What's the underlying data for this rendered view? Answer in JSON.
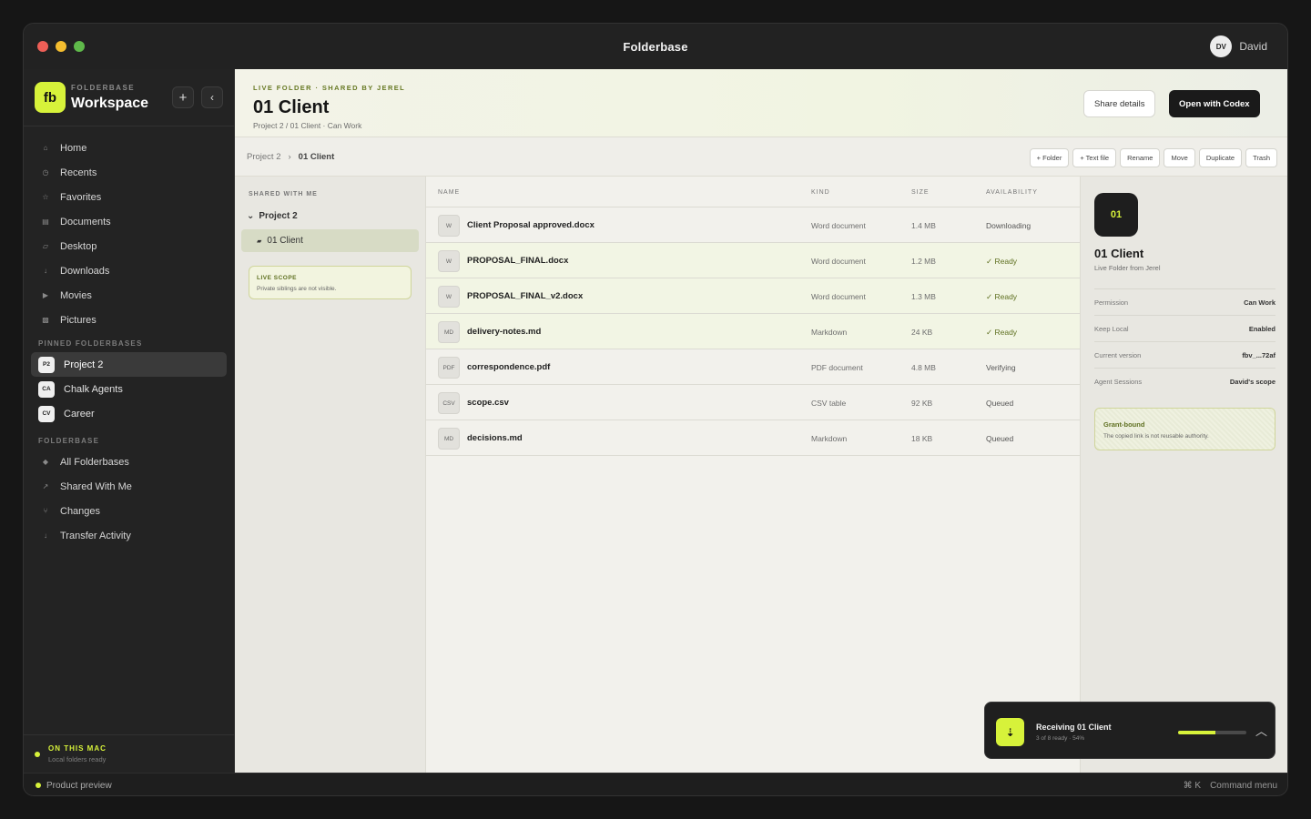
{
  "window": {
    "title": "Folderbase",
    "user_initials": "DV",
    "user_name": "David"
  },
  "sidebar": {
    "logo": "fb",
    "kicker": "FOLDERBASE",
    "workspace": "Workspace",
    "nav": [
      {
        "label": "Home",
        "icon": "home-icon"
      },
      {
        "label": "Recents",
        "icon": "clock-icon"
      },
      {
        "label": "Favorites",
        "icon": "star-icon"
      },
      {
        "label": "Documents",
        "icon": "document-icon"
      },
      {
        "label": "Desktop",
        "icon": "desktop-icon"
      },
      {
        "label": "Downloads",
        "icon": "download-icon"
      },
      {
        "label": "Movies",
        "icon": "play-icon"
      },
      {
        "label": "Pictures",
        "icon": "picture-icon"
      }
    ],
    "pinned_header": "PINNED FOLDERBASES",
    "pinned": [
      {
        "badge": "P2",
        "label": "Project 2"
      },
      {
        "badge": "CA",
        "label": "Chalk Agents"
      },
      {
        "badge": "CV",
        "label": "Career"
      }
    ],
    "folderbase_header": "FOLDERBASE",
    "folderbase": [
      {
        "label": "All Folderbases",
        "icon": "diamond-icon"
      },
      {
        "label": "Shared With Me",
        "icon": "arrow-up-right-icon"
      },
      {
        "label": "Changes",
        "icon": "branch-icon"
      },
      {
        "label": "Transfer Activity",
        "icon": "arrow-down-icon"
      }
    ],
    "footer_title": "ON THIS MAC",
    "footer_sub": "Local folders ready"
  },
  "header": {
    "kicker": "LIVE FOLDER · SHARED BY JEREL",
    "title": "01 Client",
    "path": "Project 2 / 01 Client · Can Work",
    "share_label": "Share details",
    "open_label": "Open with Codex"
  },
  "toolbar": {
    "crumb_parent": "Project 2",
    "crumb_sep": "›",
    "crumb_current": "01 Client",
    "actions": [
      "+ Folder",
      "+ Text file",
      "Rename",
      "Move",
      "Duplicate",
      "Trash"
    ]
  },
  "tree": {
    "kicker": "SHARED WITH ME",
    "chevron": "⌄",
    "project": "Project 2",
    "selected": "01 Client",
    "scope_title": "LIVE SCOPE",
    "scope_sub": "Private siblings are not visible."
  },
  "files": {
    "columns": {
      "name": "NAME",
      "kind": "KIND",
      "size": "SIZE",
      "availability": "AVAILABILITY"
    },
    "rows": [
      {
        "type": "W",
        "name": "Client Proposal approved.docx",
        "kind": "Word document",
        "size": "1.4 MB",
        "availability": "Downloading"
      },
      {
        "type": "W",
        "name": "PROPOSAL_FINAL.docx",
        "kind": "Word document",
        "size": "1.2 MB",
        "availability": "✓ Ready"
      },
      {
        "type": "W",
        "name": "PROPOSAL_FINAL_v2.docx",
        "kind": "Word document",
        "size": "1.3 MB",
        "availability": "✓ Ready"
      },
      {
        "type": "MD",
        "name": "delivery-notes.md",
        "kind": "Markdown",
        "size": "24 KB",
        "availability": "✓ Ready"
      },
      {
        "type": "PDF",
        "name": "correspondence.pdf",
        "kind": "PDF document",
        "size": "4.8 MB",
        "availability": "Verifying"
      },
      {
        "type": "CSV",
        "name": "scope.csv",
        "kind": "CSV table",
        "size": "92 KB",
        "availability": "Queued"
      },
      {
        "type": "MD",
        "name": "decisions.md",
        "kind": "Markdown",
        "size": "18 KB",
        "availability": "Queued"
      }
    ]
  },
  "detail": {
    "badge": "01",
    "title": "01 Client",
    "sub": "Live Folder from Jerel",
    "props": [
      {
        "k": "Permission",
        "v": "Can Work"
      },
      {
        "k": "Keep Local",
        "v": "Enabled"
      },
      {
        "k": "Current version",
        "v": "fbv_...72af"
      },
      {
        "k": "Agent Sessions",
        "v": "David's scope"
      }
    ],
    "grant_title": "Grant-bound",
    "grant_sub": "The copied link is not reusable authority."
  },
  "toast": {
    "icon": "download-icon",
    "title": "Receiving 01 Client",
    "sub": "3 of 8 ready · 54%",
    "progress": 0.54
  },
  "statusbar": {
    "left": "Product preview",
    "shortcut": "⌘ K",
    "right": "Command menu"
  },
  "colors": {
    "accent": "#d7f23a",
    "dark": "#1e1e1e",
    "ready": "#5f7021"
  }
}
